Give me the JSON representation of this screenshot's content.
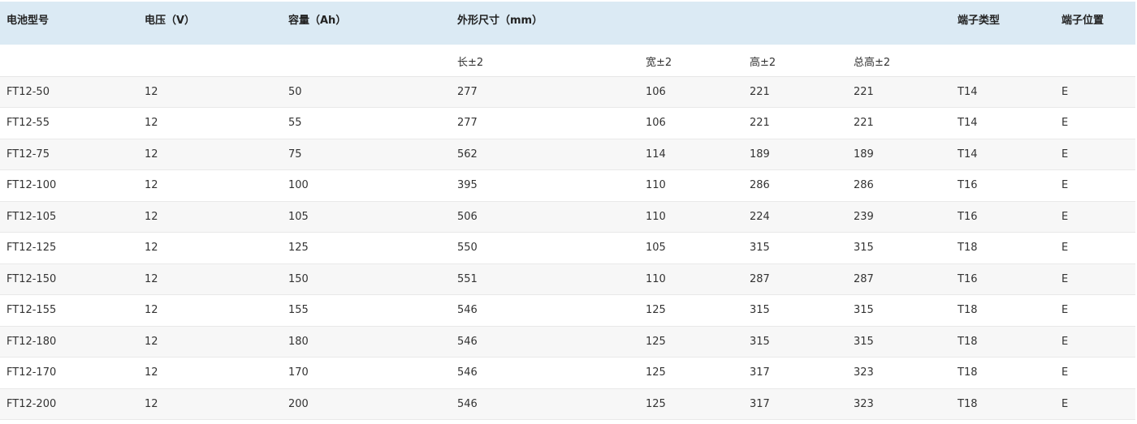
{
  "table": {
    "headers": [
      "电池型号",
      "电压（V）",
      "容量（Ah）",
      "外形尺寸（mm）",
      "",
      "",
      "",
      "端子类型",
      "端子位置"
    ],
    "subheaders": [
      "",
      "",
      "",
      "长±2",
      "宽±2",
      "高±2",
      "总高±2",
      "",
      ""
    ],
    "rows": [
      [
        "FT12-50",
        "12",
        "50",
        "277",
        "106",
        "221",
        "221",
        "T14",
        "E"
      ],
      [
        "FT12-55",
        "12",
        "55",
        "277",
        "106",
        "221",
        "221",
        "T14",
        "E"
      ],
      [
        "FT12-75",
        "12",
        "75",
        "562",
        "114",
        "189",
        "189",
        "T14",
        "E"
      ],
      [
        "FT12-100",
        "12",
        "100",
        "395",
        "110",
        "286",
        "286",
        "T16",
        "E"
      ],
      [
        "FT12-105",
        "12",
        "105",
        "506",
        "110",
        "224",
        "239",
        "T16",
        "E"
      ],
      [
        "FT12-125",
        "12",
        "125",
        "550",
        "105",
        "315",
        "315",
        "T18",
        "E"
      ],
      [
        "FT12-150",
        "12",
        "150",
        "551",
        "110",
        "287",
        "287",
        "T16",
        "E"
      ],
      [
        "FT12-155",
        "12",
        "155",
        "546",
        "125",
        "315",
        "315",
        "T18",
        "E"
      ],
      [
        "FT12-180",
        "12",
        "180",
        "546",
        "125",
        "315",
        "315",
        "T18",
        "E"
      ],
      [
        "FT12-170",
        "12",
        "170",
        "546",
        "125",
        "317",
        "323",
        "T18",
        "E"
      ],
      [
        "FT12-200",
        "12",
        "200",
        "546",
        "125",
        "317",
        "323",
        "T18",
        "E"
      ]
    ]
  },
  "colors": {
    "header_bg": "#dbeaf4",
    "row_stripe": "#f7f7f7",
    "border": "#e9e9e9"
  }
}
